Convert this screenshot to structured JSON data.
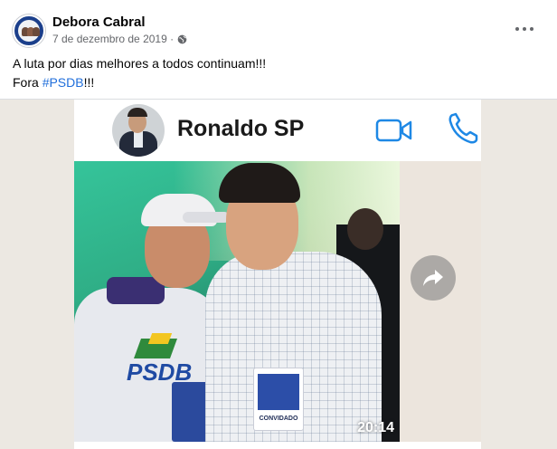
{
  "post": {
    "author": "Debora Cabral",
    "date": "7 de dezembro de 2019 ·",
    "text_line1": "A luta por dias melhores a todos continuam!!!",
    "text_line2_prefix": "Fora ",
    "hashtag": "#PSDB",
    "text_line2_suffix": "!!!"
  },
  "screenshot": {
    "contact_name": "Ronaldo SP",
    "time": "20:14",
    "badge_left_text": "PSDB",
    "badge_right_text": "CONVIDADO"
  },
  "colors": {
    "link": "#216fdb",
    "whatsapp_blue": "#1e88e5"
  },
  "icons": {
    "audience": "globe-icon",
    "options": "more-icon",
    "video_call": "video-camera-icon",
    "voice_call": "phone-icon",
    "forward": "forward-arrow-icon"
  }
}
